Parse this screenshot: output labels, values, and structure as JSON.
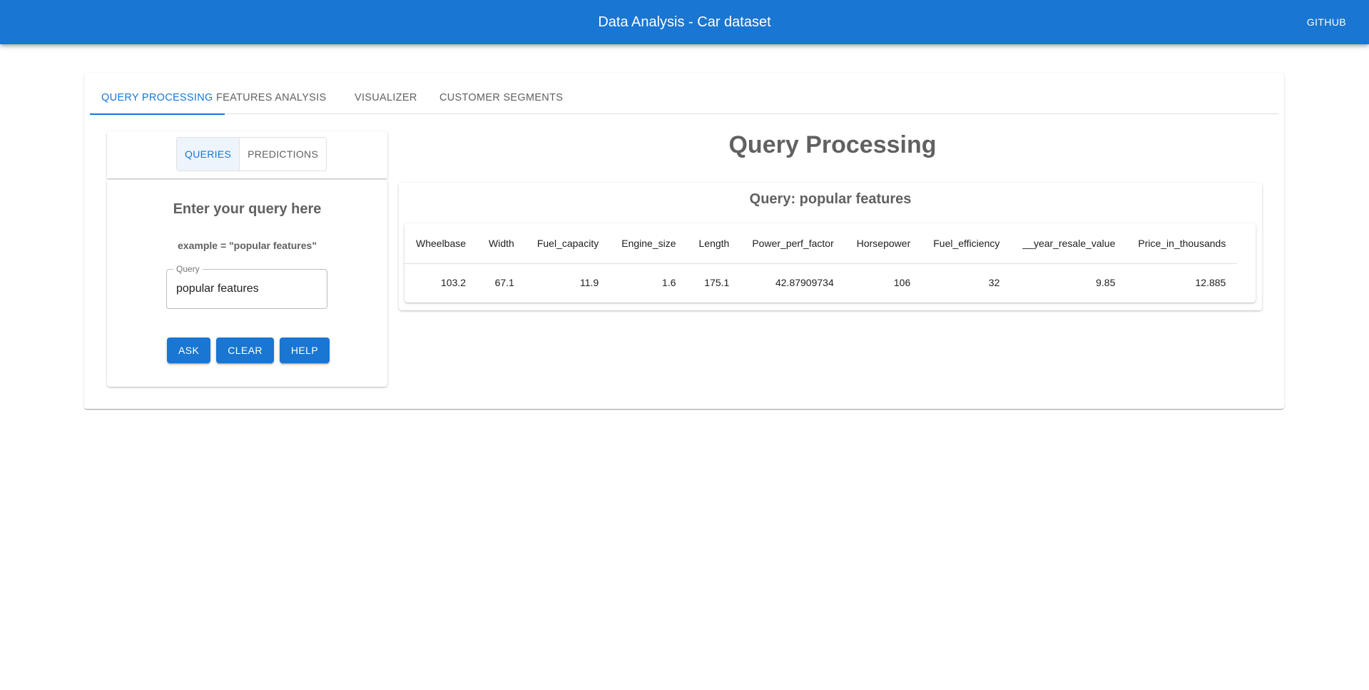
{
  "appbar": {
    "title": "Data Analysis - Car dataset",
    "github_label": "GITHUB"
  },
  "tabs": [
    {
      "label": "QUERY PROCESSING",
      "active": true
    },
    {
      "label": "FEATURES ANALYSIS",
      "active": false
    },
    {
      "label": "VISUALIZER",
      "active": false
    },
    {
      "label": "CUSTOMER SEGMENTS",
      "active": false
    }
  ],
  "mode_toggle": [
    {
      "label": "QUERIES",
      "selected": true
    },
    {
      "label": "PREDICTIONS",
      "selected": false
    }
  ],
  "query_form": {
    "heading": "Enter your query here",
    "example": "example = \"popular features\"",
    "field_label": "Query",
    "field_value": "popular features",
    "buttons": [
      "ASK",
      "CLEAR",
      "HELP"
    ]
  },
  "main": {
    "title": "Query Processing",
    "result_title": "Query: popular features"
  },
  "table": {
    "columns": [
      "Wheelbase",
      "Width",
      "Fuel_capacity",
      "Engine_size",
      "Length",
      "Power_perf_factor",
      "Horsepower",
      "Fuel_efficiency",
      "__year_resale_value",
      "Price_in_thousands"
    ],
    "rows": [
      [
        "103.2",
        "67.1",
        "11.9",
        "1.6",
        "175.1",
        "42.87909734",
        "106",
        "32",
        "9.85",
        "12.885"
      ]
    ]
  },
  "colors": {
    "primary": "#1976d2",
    "heading_gray": "#616161"
  }
}
